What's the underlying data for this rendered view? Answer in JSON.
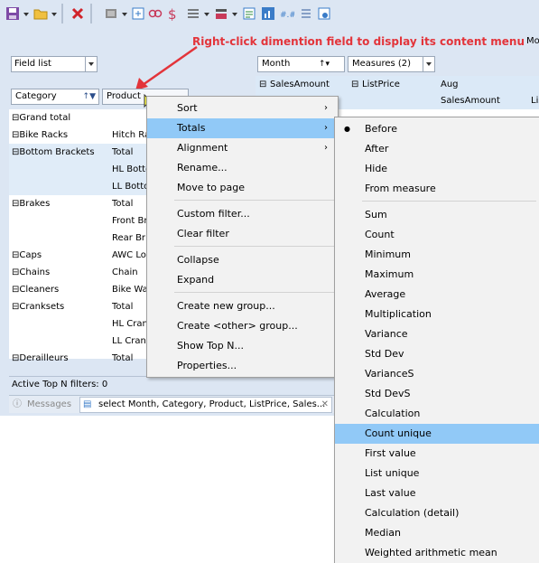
{
  "toolbar": {
    "icons": [
      "save-icon",
      "open-folder-icon",
      "delete-icon",
      "layout-icon",
      "export-icon",
      "link-icon",
      "dollar-icon",
      "list-icon",
      "color-icon",
      "format-icon",
      "chart-icon",
      "number-format-icon",
      "filter-list-icon",
      "settings-icon"
    ]
  },
  "annotation": "Right-click dimention field to display its content menu",
  "mo_label": "Mo",
  "field_list": "Field list",
  "header_fields": {
    "month": "Month",
    "measures": "Measures (2)"
  },
  "col_headers": {
    "sales_amount": "SalesAmount",
    "list_price": "ListPrice",
    "aug": "Aug",
    "aug_sales": "SalesAmount",
    "li": "Lis"
  },
  "row_fields": {
    "category": "Category",
    "product": "Product"
  },
  "grid_rows": [
    {
      "cat": "Grand total",
      "prod": ""
    },
    {
      "cat": "Bike Racks",
      "prod": "Hitch Ra"
    },
    {
      "cat": "Bottom Brackets",
      "prod": "Total"
    },
    {
      "cat": "",
      "prod": "HL Botto"
    },
    {
      "cat": "",
      "prod": "LL Botto"
    },
    {
      "cat": "Brakes",
      "prod": "Total"
    },
    {
      "cat": "",
      "prod": "Front Br"
    },
    {
      "cat": "",
      "prod": "Rear Br"
    },
    {
      "cat": "Caps",
      "prod": "AWC Lo"
    },
    {
      "cat": "Chains",
      "prod": "Chain"
    },
    {
      "cat": "Cleaners",
      "prod": "Bike Wa"
    },
    {
      "cat": "Cranksets",
      "prod": "Total"
    },
    {
      "cat": "",
      "prod": "HL Cran"
    },
    {
      "cat": "",
      "prod": "LL Cran"
    },
    {
      "cat": "Derailleurs",
      "prod": "Total"
    }
  ],
  "status": "Active Top N filters: 0",
  "tabs": {
    "messages": "Messages",
    "query": "select Month, Category, Product, ListPrice, Sales..."
  },
  "context_menu": {
    "items": [
      "Sort",
      "Totals",
      "Alignment",
      "Rename...",
      "Move to page",
      "Custom filter...",
      "Clear filter",
      "Collapse",
      "Expand",
      "Create new group...",
      "Create <other> group...",
      "Show Top N...",
      "Properties..."
    ]
  },
  "totals_submenu": {
    "items": [
      "Before",
      "After",
      "Hide",
      "From measure",
      "Sum",
      "Count",
      "Minimum",
      "Maximum",
      "Average",
      "Multiplication",
      "Variance",
      "Std Dev",
      "VarianceS",
      "Std DevS",
      "Calculation",
      "Count unique",
      "First value",
      "List unique",
      "Last value",
      "Calculation (detail)",
      "Median",
      "Weighted arithmetic mean"
    ],
    "checked": "Before",
    "highlighted": "Count unique"
  },
  "colors": {
    "accent_highlight": "#91c9f7",
    "annotation": "#e3343a",
    "app_bg": "#dce6f3"
  }
}
